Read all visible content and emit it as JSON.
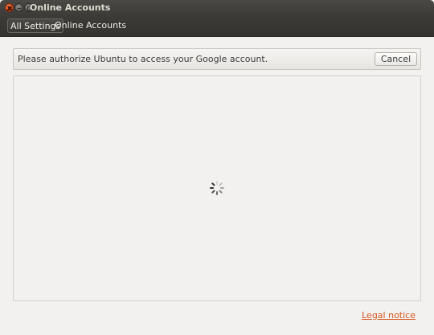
{
  "window": {
    "title": "Online Accounts"
  },
  "toolbar": {
    "breadcrumb_all": "All Settings",
    "breadcrumb_current": "Online Accounts"
  },
  "info_bar": {
    "message": "Please authorize Ubuntu to access your Google account.",
    "cancel_label": "Cancel"
  },
  "web_view": {
    "state": "loading"
  },
  "footer": {
    "legal_notice": "Legal notice"
  },
  "icons": {
    "close": "close-icon",
    "minimize": "minimize-icon",
    "maximize": "maximize-icon",
    "spinner": "loading-spinner-icon"
  },
  "colors": {
    "titlebar": "#3c3b37",
    "close_button": "#df4a16",
    "link": "#d7561d",
    "window_bg": "#f2f1f0"
  }
}
